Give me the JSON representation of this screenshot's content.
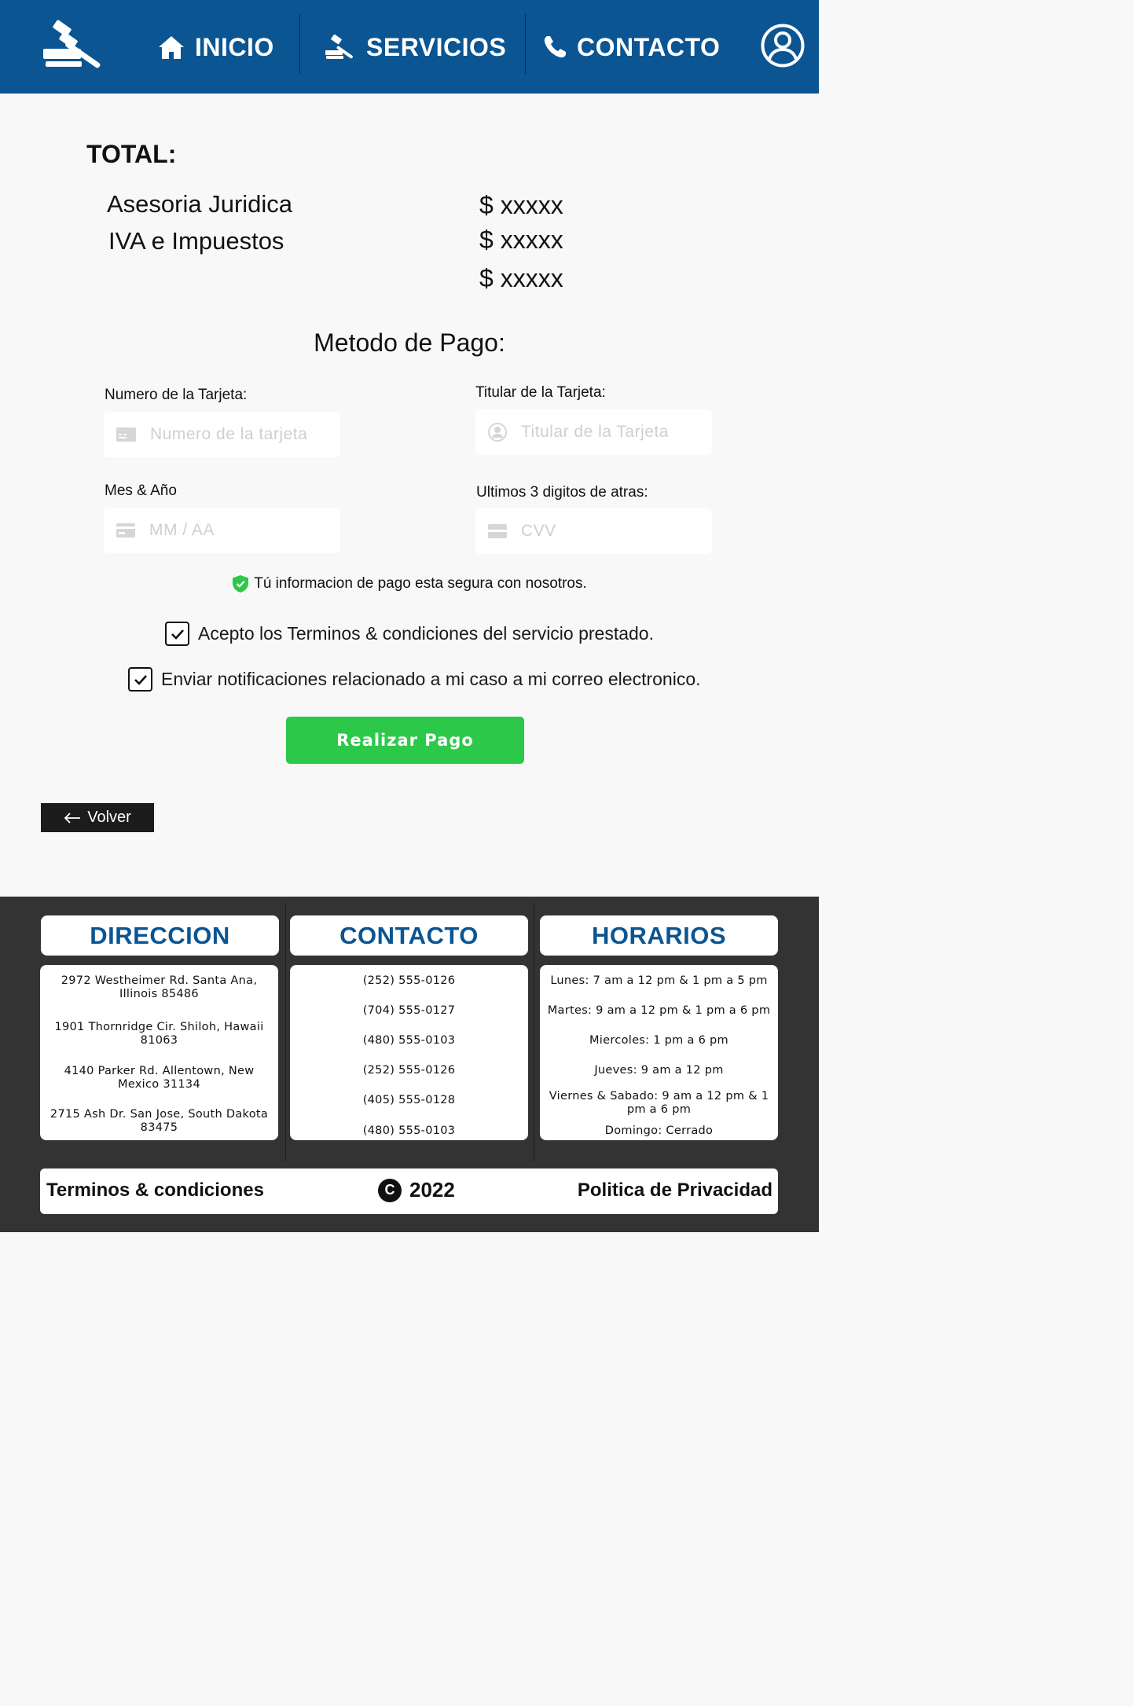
{
  "nav": {
    "inicio": "INICIO",
    "servicios": "SERVICIOS",
    "contacto": "CONTACTO"
  },
  "summary": {
    "title": "TOTAL:",
    "lines": [
      {
        "label": "Asesoria Juridica",
        "price": "$ xxxxx"
      },
      {
        "label": "IVA e Impuestos",
        "price": "$ xxxxx"
      }
    ],
    "total_price": "$ xxxxx"
  },
  "payment": {
    "title": "Metodo de Pago:",
    "card_number": {
      "label": "Numero de la Tarjeta:",
      "placeholder": "Numero de la tarjeta",
      "value": ""
    },
    "card_holder": {
      "label": "Titular de la Tarjeta:",
      "placeholder": "Titular de la Tarjeta",
      "value": ""
    },
    "expiry": {
      "label": "Mes & Año",
      "placeholder": "MM / AA",
      "value": ""
    },
    "cvv": {
      "label": "Ultimos 3 digitos de atras:",
      "placeholder": "CVV",
      "value": ""
    },
    "secure_note": "Tú informacion de pago esta segura con nosotros.",
    "terms_check": {
      "label": "Acepto los Terminos & condiciones del servicio prestado.",
      "checked": true
    },
    "notify_check": {
      "label": "Enviar notificaciones relacionado a mi caso a mi correo electronico.",
      "checked": true
    },
    "submit_label": "Realizar Pago"
  },
  "back_label": "Volver",
  "footer": {
    "direccion": {
      "title": "DIRECCION",
      "items": [
        "2972 Westheimer Rd. Santa Ana, Illinois 85486",
        "1901 Thornridge Cir. Shiloh, Hawaii 81063",
        "4140 Parker Rd. Allentown, New Mexico 31134",
        "2715 Ash Dr. San Jose, South Dakota 83475"
      ]
    },
    "contacto": {
      "title": "CONTACTO",
      "items": [
        "(252) 555-0126",
        "(704) 555-0127",
        "(480) 555-0103",
        "(252) 555-0126",
        "(405) 555-0128",
        "(480) 555-0103"
      ]
    },
    "horarios": {
      "title": "HORARIOS",
      "items": [
        "Lunes: 7 am a 12 pm & 1 pm a 5 pm",
        "Martes: 9 am a 12 pm & 1 pm a 6 pm",
        "Miercoles: 1 pm a 6 pm",
        "Jueves: 9 am a 12 pm",
        "Viernes & Sabado: 9 am a 12 pm & 1 pm a 6 pm",
        "Domingo: Cerrado"
      ]
    },
    "terms": "Terminos & condiciones",
    "copyright_symbol": "C",
    "year": "2022",
    "privacy": "Politica de Privacidad"
  },
  "colors": {
    "header": "#0a5592",
    "accent_green": "#2cc84a",
    "footer_bg": "#333333",
    "heading_blue": "#0a5592"
  }
}
